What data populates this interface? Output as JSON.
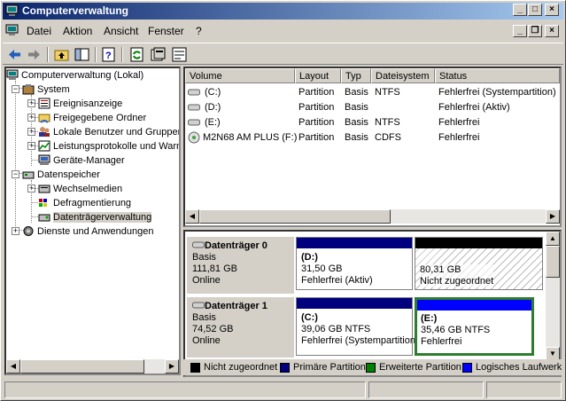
{
  "window": {
    "title": "Computerverwaltung"
  },
  "menu": [
    "Datei",
    "Aktion",
    "Ansicht",
    "Fenster",
    "?"
  ],
  "tree": {
    "root": "Computerverwaltung (Lokal)",
    "system": "System",
    "system_items": [
      "Ereignisanzeige",
      "Freigegebene Ordner",
      "Lokale Benutzer und Gruppen",
      "Leistungsprotokolle und Warnungen",
      "Geräte-Manager"
    ],
    "storage": "Datenspeicher",
    "storage_items": [
      "Wechselmedien",
      "Defragmentierung",
      "Datenträgerverwaltung"
    ],
    "services": "Dienste und Anwendungen"
  },
  "list": {
    "columns": [
      "Volume",
      "Layout",
      "Typ",
      "Dateisystem",
      "Status"
    ],
    "rows": [
      [
        "(C:)",
        "Partition",
        "Basis",
        "NTFS",
        "Fehlerfrei (Systempartition)"
      ],
      [
        "(D:)",
        "Partition",
        "Basis",
        "",
        "Fehlerfrei (Aktiv)"
      ],
      [
        "(E:)",
        "Partition",
        "Basis",
        "NTFS",
        "Fehlerfrei"
      ],
      [
        "M2N68 AM PLUS (F:)",
        "Partition",
        "Basis",
        "CDFS",
        "Fehlerfrei"
      ]
    ]
  },
  "disks": [
    {
      "name": "Datenträger 0",
      "type": "Basis",
      "size": "111,81 GB",
      "state": "Online",
      "parts": [
        {
          "label": "(D:)",
          "size": "31,50 GB",
          "status": "Fehlerfrei (Aktiv)",
          "color": "#00007f"
        },
        {
          "label": "",
          "size": "80,31 GB",
          "status": "Nicht zugeordnet",
          "color": "#000000"
        }
      ]
    },
    {
      "name": "Datenträger 1",
      "type": "Basis",
      "size": "74,52 GB",
      "state": "Online",
      "parts": [
        {
          "label": "(C:)",
          "size": "39,06 GB NTFS",
          "status": "Fehlerfrei (Systempartition)",
          "color": "#00007f"
        },
        {
          "label": "(E:)",
          "size": "35,46 GB NTFS",
          "status": "Fehlerfrei",
          "color": "#0000ff"
        }
      ]
    }
  ],
  "legend": [
    {
      "label": "Nicht zugeordnet",
      "color": "#000000"
    },
    {
      "label": "Primäre Partition",
      "color": "#00007f"
    },
    {
      "label": "Erweiterte Partition",
      "color": "#008000"
    },
    {
      "label": "Logisches Laufwerk",
      "color": "#0000ff"
    }
  ]
}
